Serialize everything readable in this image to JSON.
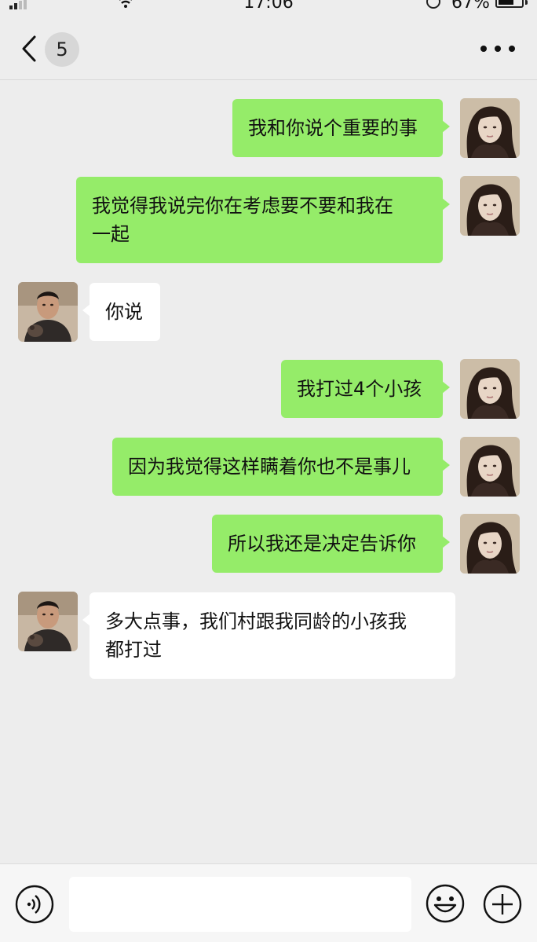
{
  "status_bar": {
    "time": "17:06",
    "battery_percent": "67%",
    "battery_level": 0.67,
    "icons": [
      "signal-icon",
      "wifi-icon",
      "rotation-lock-icon",
      "battery-icon"
    ]
  },
  "header": {
    "unread_count": "5",
    "icons": [
      "back-chevron-icon",
      "more-options-icon"
    ]
  },
  "messages": [
    {
      "side": "outgoing",
      "text": "我和你说个重要的事"
    },
    {
      "side": "outgoing",
      "text": "我觉得我说完你在考虑要不要和我在\n一起"
    },
    {
      "side": "incoming",
      "text": "你说"
    },
    {
      "side": "outgoing",
      "text": "我打过4个小孩"
    },
    {
      "side": "outgoing",
      "text": "因为我觉得这样瞒着你也不是事儿"
    },
    {
      "side": "outgoing",
      "text": "所以我还是决定告诉你"
    },
    {
      "side": "incoming",
      "text": "多大点事，我们村跟我同龄的小孩我\n都打过"
    }
  ],
  "input_bar": {
    "value": "",
    "icons": [
      "voice-icon",
      "emoji-icon",
      "plus-icon"
    ]
  },
  "colors": {
    "outgoing_bubble": "#95ec69",
    "incoming_bubble": "#ffffff",
    "background": "#ededed"
  }
}
